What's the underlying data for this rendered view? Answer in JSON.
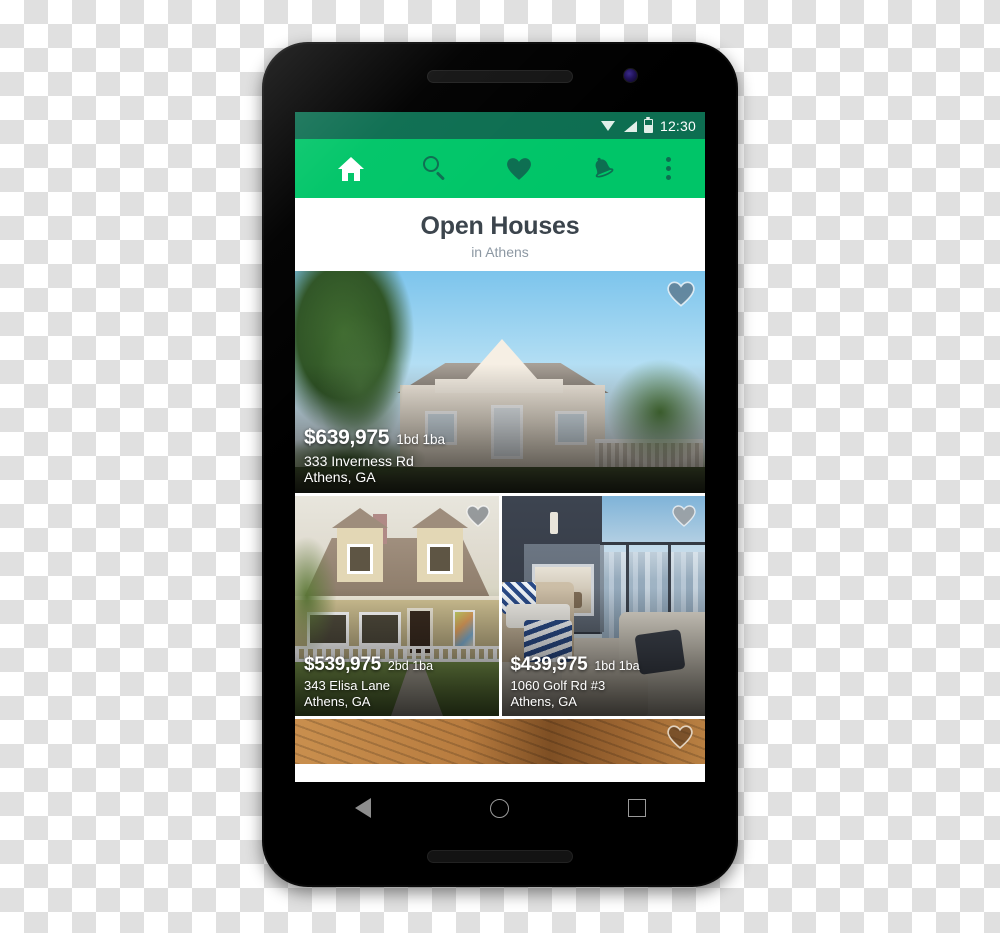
{
  "device": {
    "name": "android-smartphone",
    "earpiece": "earpiece-speaker",
    "front_camera": "front-camera",
    "bottom_speaker": "bottom-speaker"
  },
  "status_bar": {
    "time": "12:30",
    "icons": [
      "wifi-icon",
      "cell-signal-icon",
      "battery-icon"
    ],
    "background": "#0d6e51"
  },
  "app_bar": {
    "background": "#00c568",
    "active_color": "#ffffff",
    "inactive_color": "#0d6e51",
    "items": [
      {
        "name": "home-icon",
        "label": "Home",
        "active": true
      },
      {
        "name": "search-icon",
        "label": "Search",
        "active": false
      },
      {
        "name": "heart-icon",
        "label": "Favorites",
        "active": false
      },
      {
        "name": "bell-icon",
        "label": "Notifications",
        "active": false
      },
      {
        "name": "overflow-menu-icon",
        "label": "More options",
        "active": false
      }
    ]
  },
  "header": {
    "title": "Open Houses",
    "subtitle": "in Athens",
    "title_color": "#3b444c",
    "subtitle_color": "#8d98a3"
  },
  "listings": [
    {
      "price": "$639,975",
      "beds_baths": "1bd 1ba",
      "address_line1": "333 Inverness Rd",
      "address_line2": "Athens, GA",
      "favorite": false,
      "photo": "white-cottage-exterior"
    },
    {
      "price": "$539,975",
      "beds_baths": "2bd 1ba",
      "address_line1": "343 Elisa Lane",
      "address_line2": "Athens, GA",
      "favorite": false,
      "photo": "tan-dormer-house-exterior"
    },
    {
      "price": "$439,975",
      "beds_baths": "1bd 1ba",
      "address_line1": "1060 Golf Rd #3",
      "address_line2": "Athens, GA",
      "favorite": false,
      "photo": "balcony-fireplace-city-view"
    },
    {
      "price": "",
      "beds_baths": "",
      "address_line1": "",
      "address_line2": "",
      "favorite": false,
      "photo": "wooden-deck-partial"
    }
  ],
  "nav_bar": {
    "buttons": [
      {
        "name": "back-button",
        "label": "Back"
      },
      {
        "name": "home-button",
        "label": "Home"
      },
      {
        "name": "recent-apps-button",
        "label": "Recent apps"
      }
    ]
  }
}
